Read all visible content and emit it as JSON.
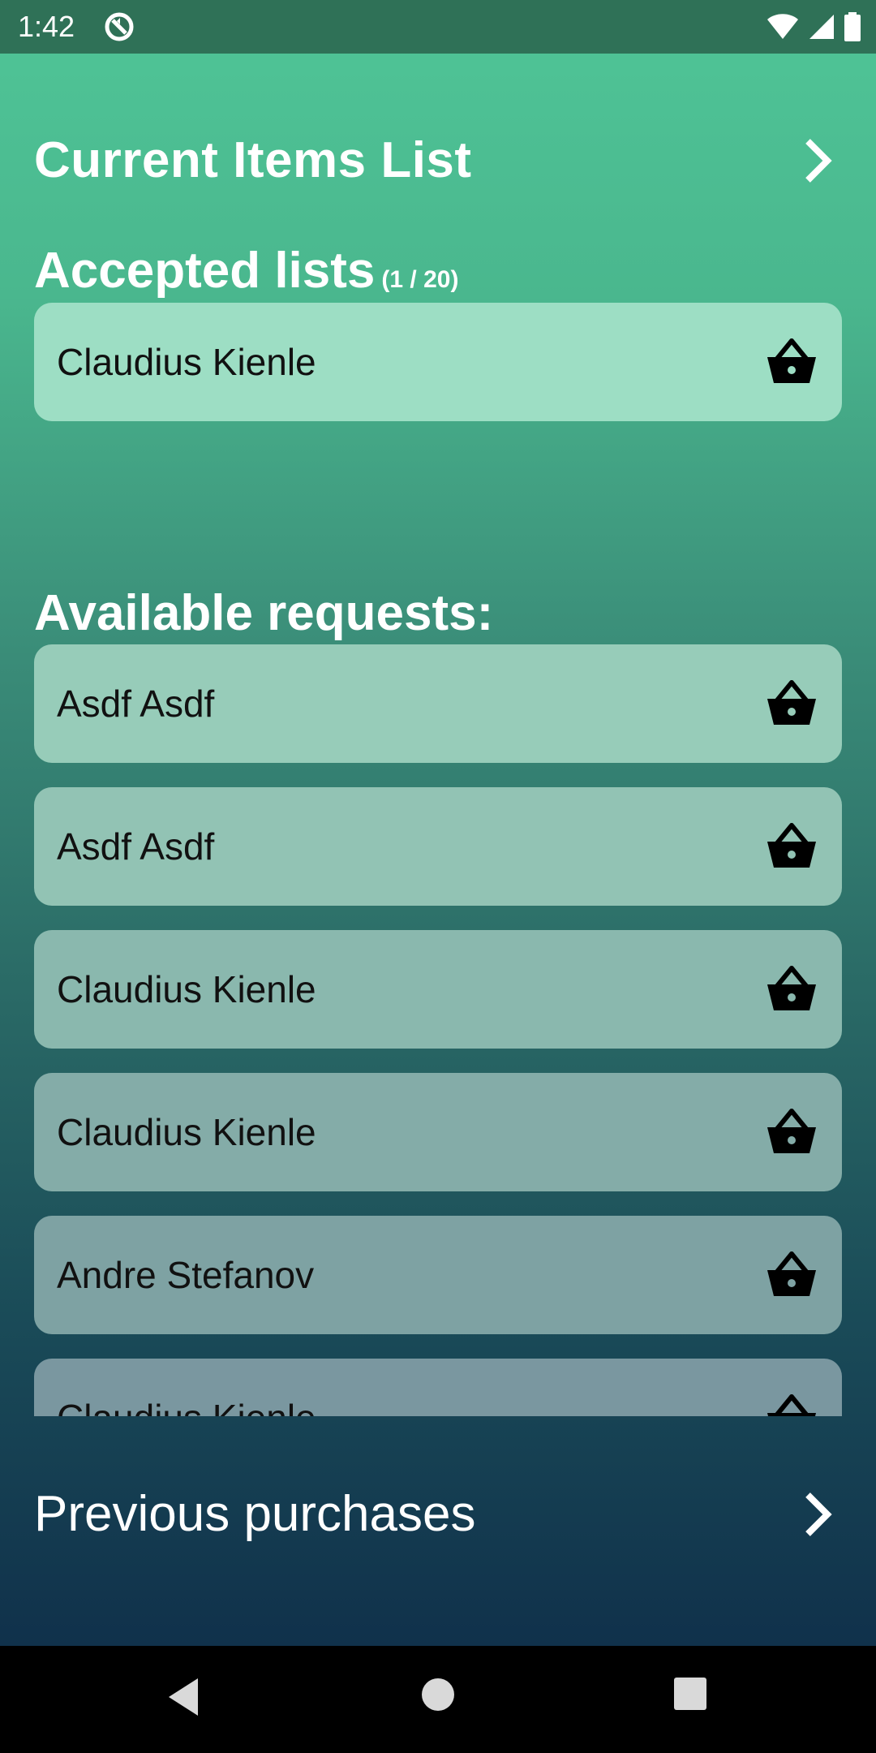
{
  "status_bar": {
    "time": "1:42"
  },
  "header": {
    "current_items_title": "Current Items List"
  },
  "accepted": {
    "title": "Accepted lists",
    "count": "(1 / 20)",
    "items": [
      {
        "name": "Claudius Kienle"
      }
    ]
  },
  "available": {
    "title": "Available requests:",
    "items": [
      {
        "name": "Asdf Asdf"
      },
      {
        "name": "Asdf Asdf"
      },
      {
        "name": "Claudius Kienle"
      },
      {
        "name": "Claudius Kienle"
      },
      {
        "name": "Andre Stefanov"
      },
      {
        "name": "Claudius Kienle"
      }
    ]
  },
  "footer": {
    "previous_purchases": "Previous purchases"
  },
  "icons": {
    "chevron": "chevron-right-icon",
    "basket": "basket-icon",
    "back": "back-triangle-icon",
    "home": "home-circle-icon",
    "recents": "recents-square-icon"
  },
  "colors": {
    "accent_top": "#4fc597",
    "accent_bottom": "#10314b"
  }
}
